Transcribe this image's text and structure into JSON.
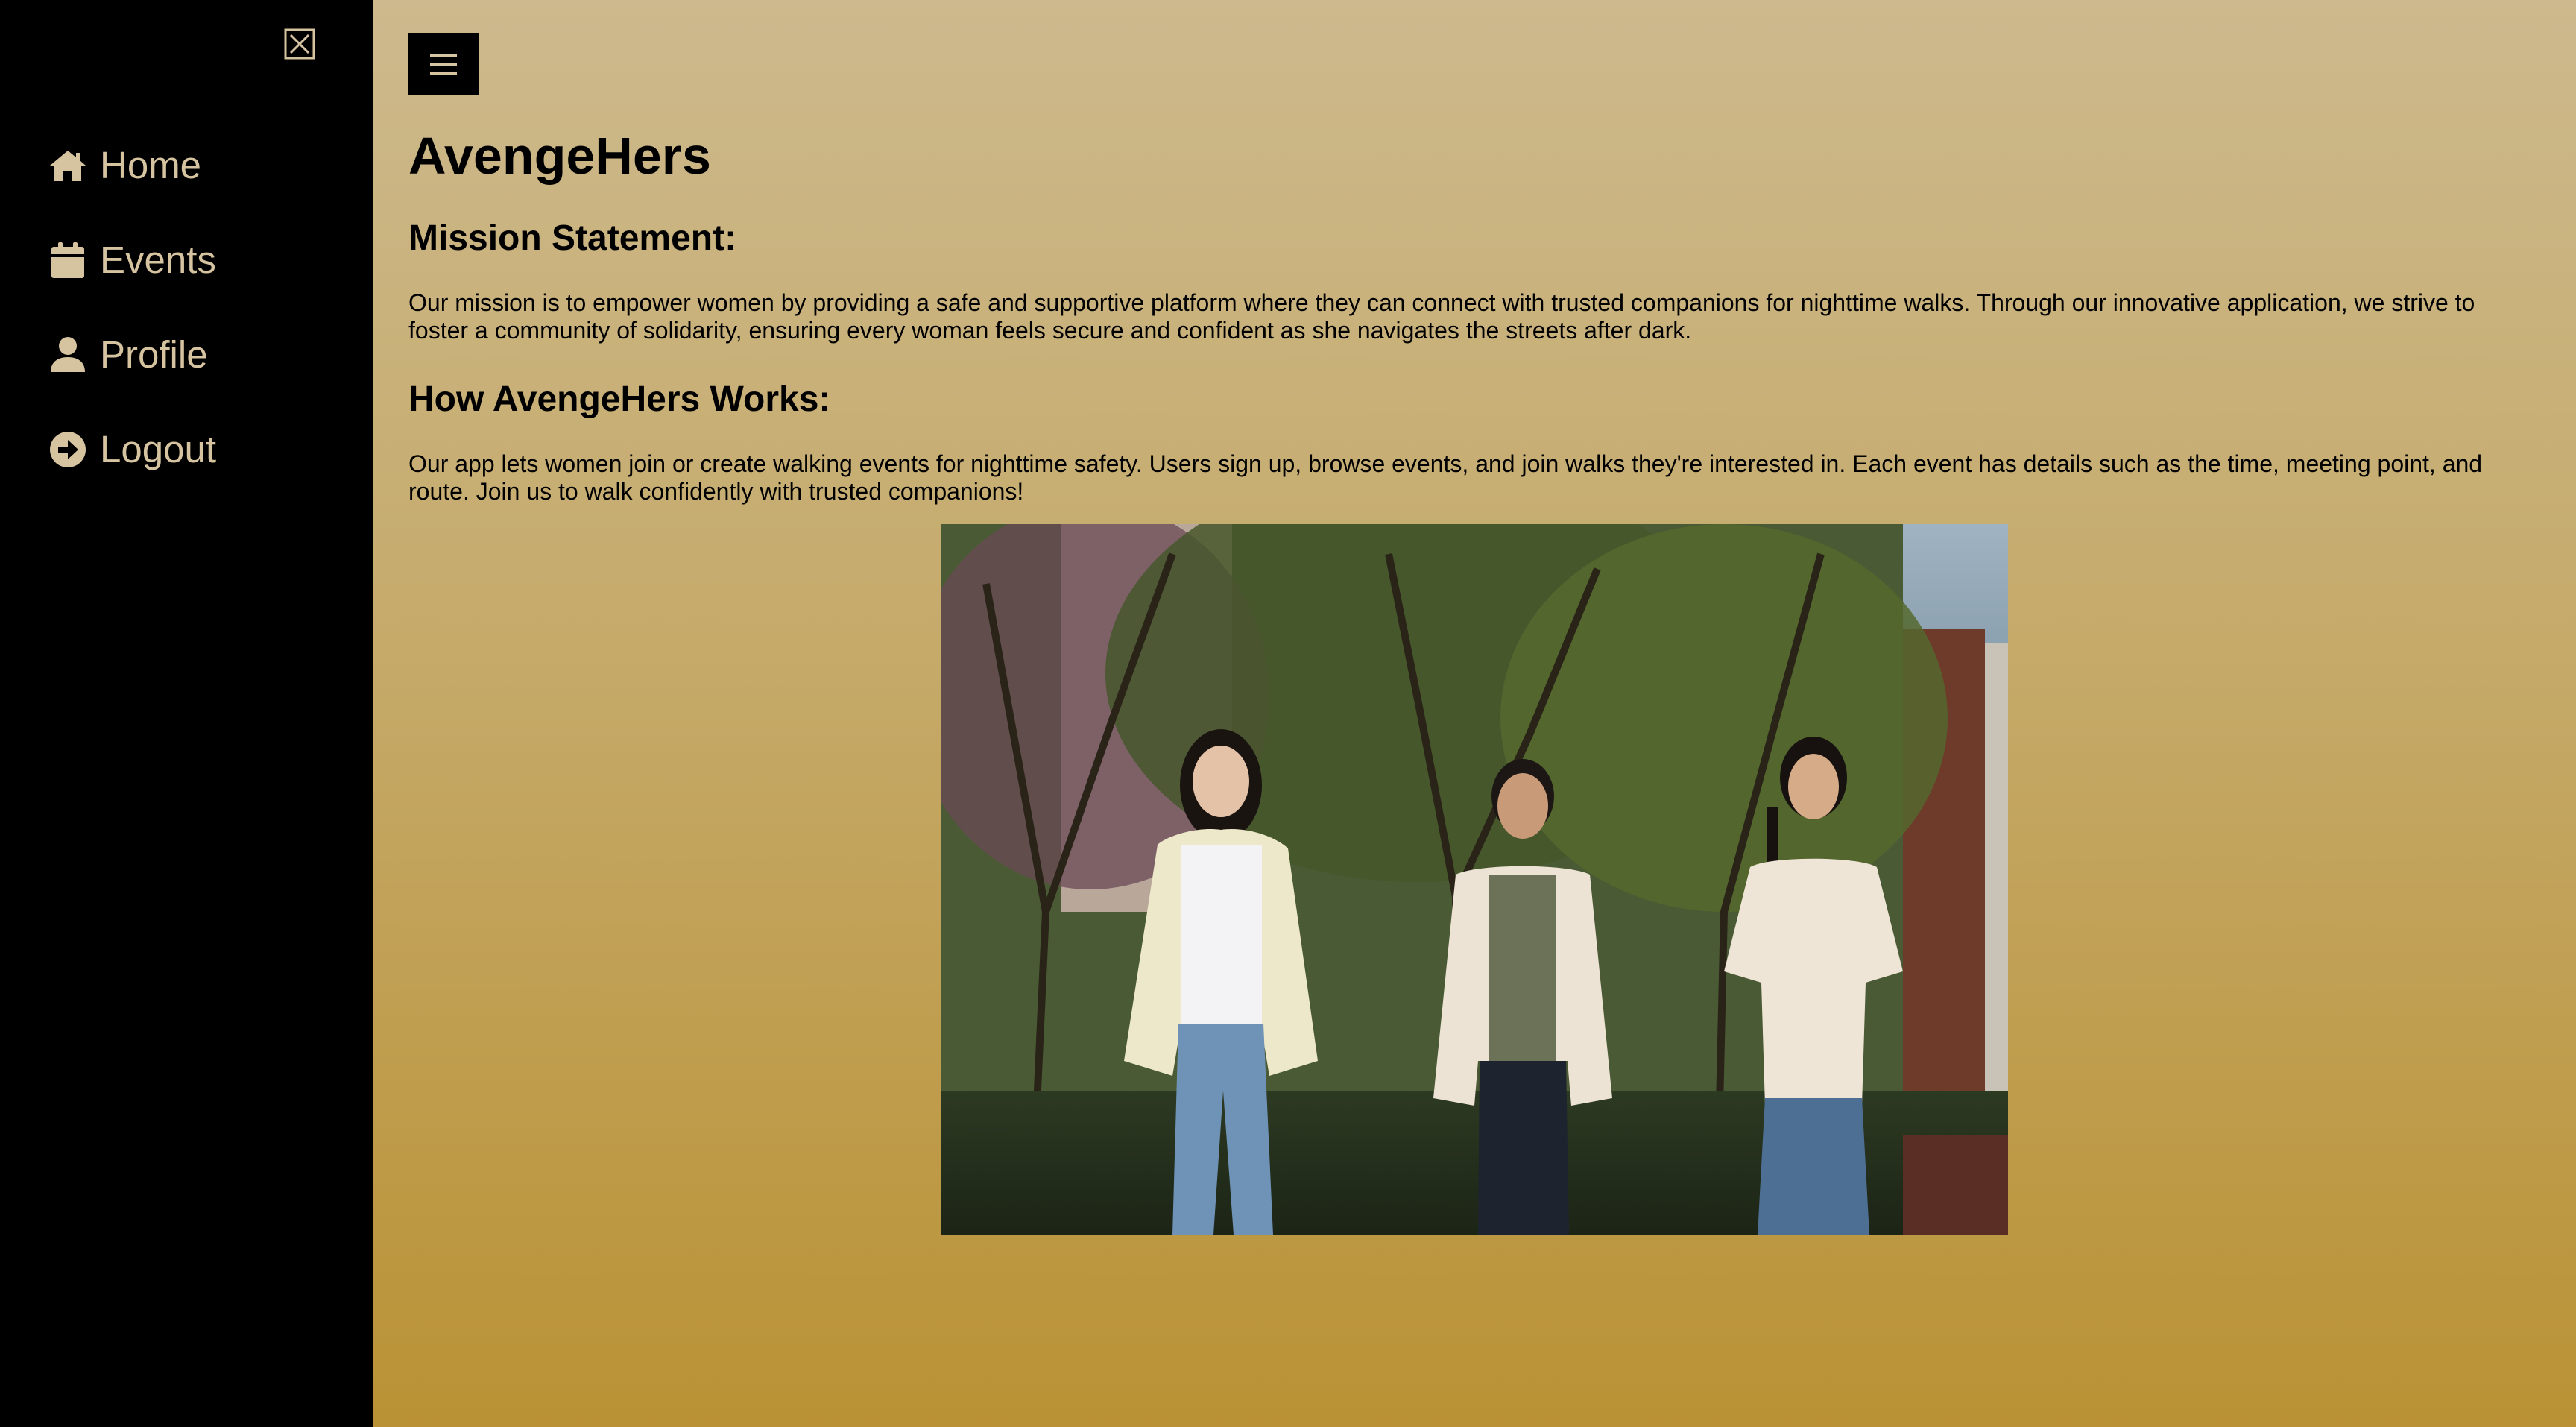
{
  "sidebar": {
    "close_icon": "close-icon",
    "items": [
      {
        "label": "Home",
        "icon": "home-icon"
      },
      {
        "label": "Events",
        "icon": "calendar-icon"
      },
      {
        "label": "Profile",
        "icon": "user-icon"
      },
      {
        "label": "Logout",
        "icon": "logout-icon"
      }
    ]
  },
  "header": {
    "menu_icon": "hamburger-icon"
  },
  "main": {
    "title": "AvengeHers",
    "mission_heading": "Mission Statement:",
    "mission_text": "Our mission is to empower women by providing a safe and supportive platform where they can connect with trusted companions for nighttime walks. Through our innovative application, we strive to foster a community of solidarity, ensuring every woman feels secure and confident as she navigates the streets after dark.",
    "works_heading": "How AvengeHers Works:",
    "works_text": "Our app lets women join or create walking events for nighttime safety. Users sign up, browse events, and join walks they're interested in. Each event has details such as the time, meeting point, and route. Join us to walk confidently with trusted companions!"
  },
  "colors": {
    "sidebar_bg": "#000000",
    "nav_text": "#d6c3a0",
    "gradient_top": "#cdb98d",
    "gradient_bottom": "#ba9235"
  }
}
